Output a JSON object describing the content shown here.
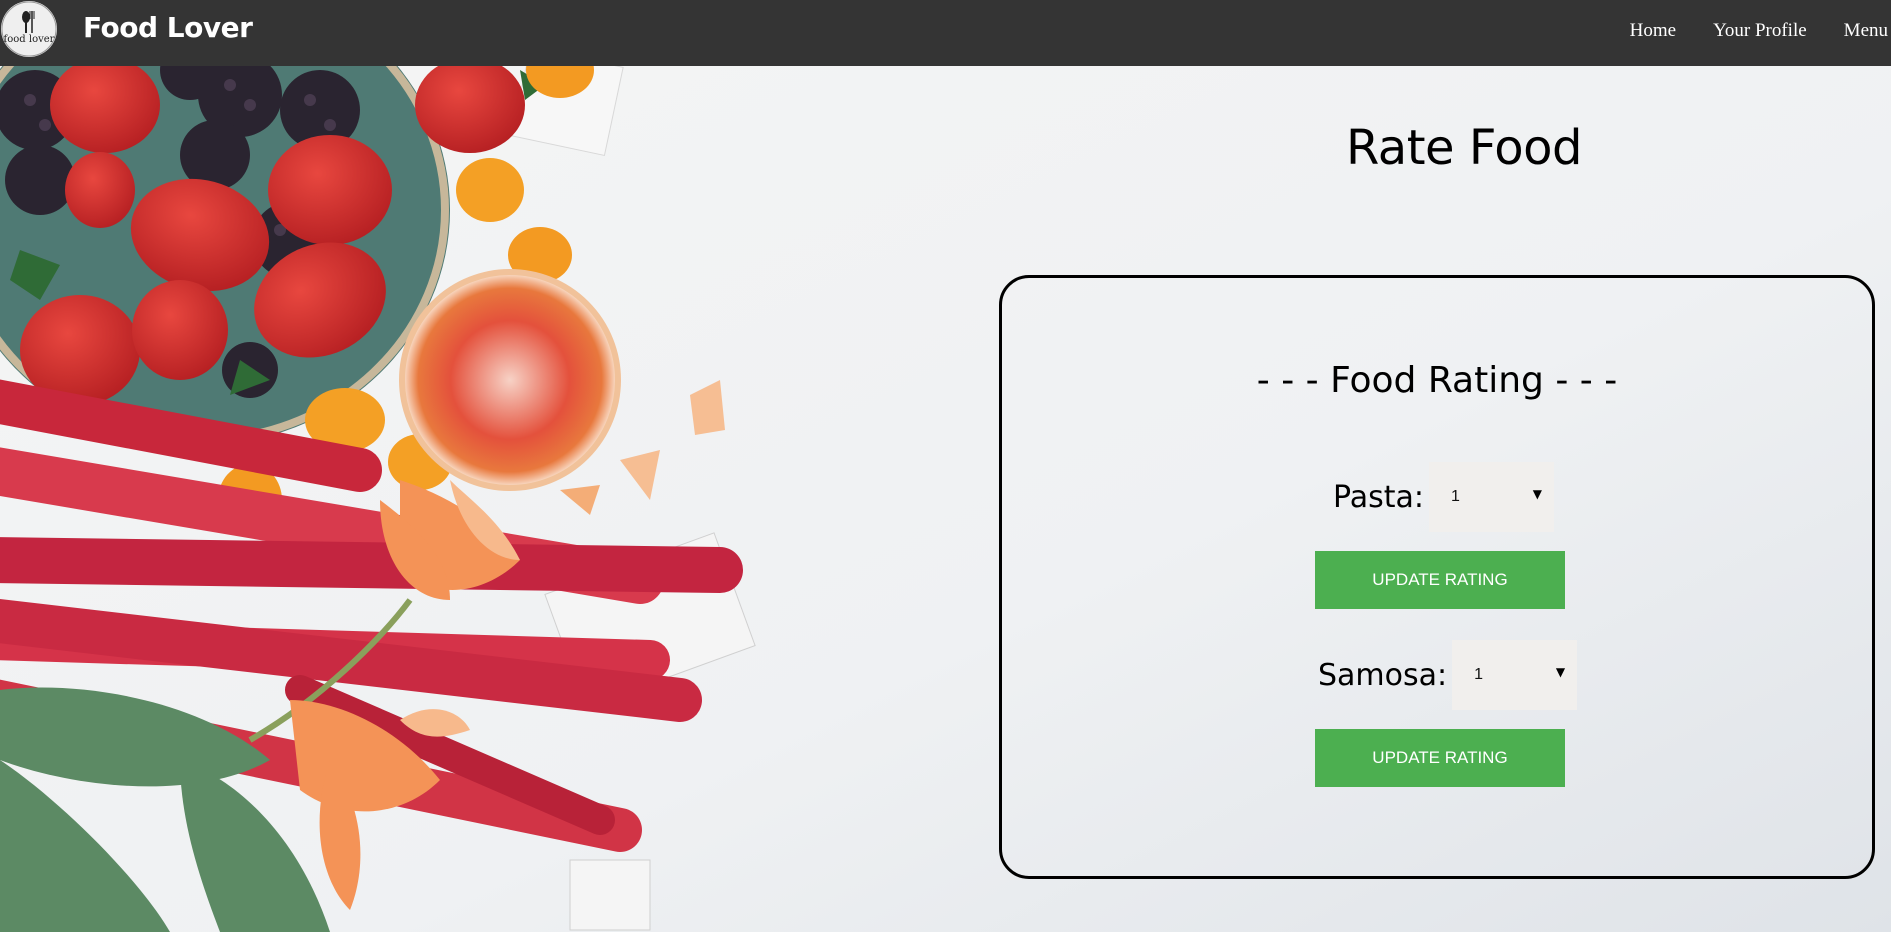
{
  "navbar": {
    "logo_text": "food lover",
    "brand": "Food Lover",
    "links": [
      "Home",
      "Your Profile",
      "Menu"
    ]
  },
  "page": {
    "title": "Rate Food"
  },
  "rating_card": {
    "heading": "- - - Food Rating - - -",
    "items": [
      {
        "label": "Pasta:",
        "selected": "1",
        "button": "UPDATE RATING"
      },
      {
        "label": "Samosa:",
        "selected": "1",
        "button": "UPDATE RATING"
      }
    ]
  },
  "colors": {
    "navbar_bg": "#343434",
    "button_bg": "#4caf50",
    "page_bg": "#f1f2f3"
  }
}
